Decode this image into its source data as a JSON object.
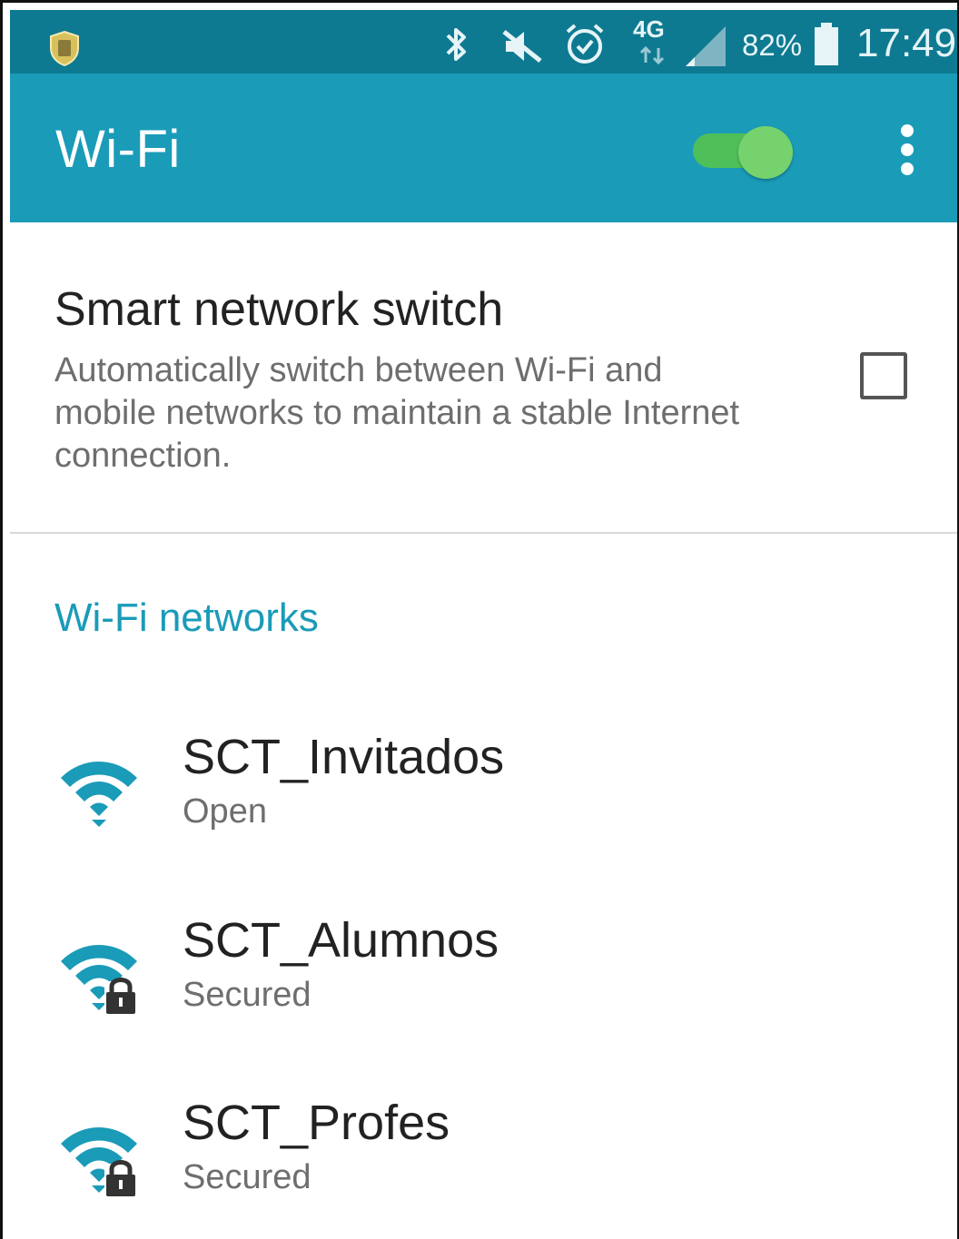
{
  "status_bar": {
    "network_type": "4G",
    "battery_percent": "82%",
    "time": "17:49"
  },
  "app_bar": {
    "title": "Wi-Fi",
    "wifi_enabled": true
  },
  "smart_network_switch": {
    "title": "Smart network switch",
    "description": "Automatically switch between Wi-Fi and mobile networks to maintain a stable Internet connection.",
    "checked": false
  },
  "wifi_networks": {
    "header": "Wi-Fi networks",
    "items": [
      {
        "name": "SCT_Invitados",
        "status": "Open",
        "secured": false
      },
      {
        "name": "SCT_Alumnos",
        "status": "Secured",
        "secured": true
      },
      {
        "name": "SCT_Profes",
        "status": "Secured",
        "secured": true
      }
    ]
  },
  "colors": {
    "status_bar": "#0e7a91",
    "app_bar": "#1a9bb8",
    "accent": "#1a9bb8",
    "toggle_on": "#76d26c"
  }
}
